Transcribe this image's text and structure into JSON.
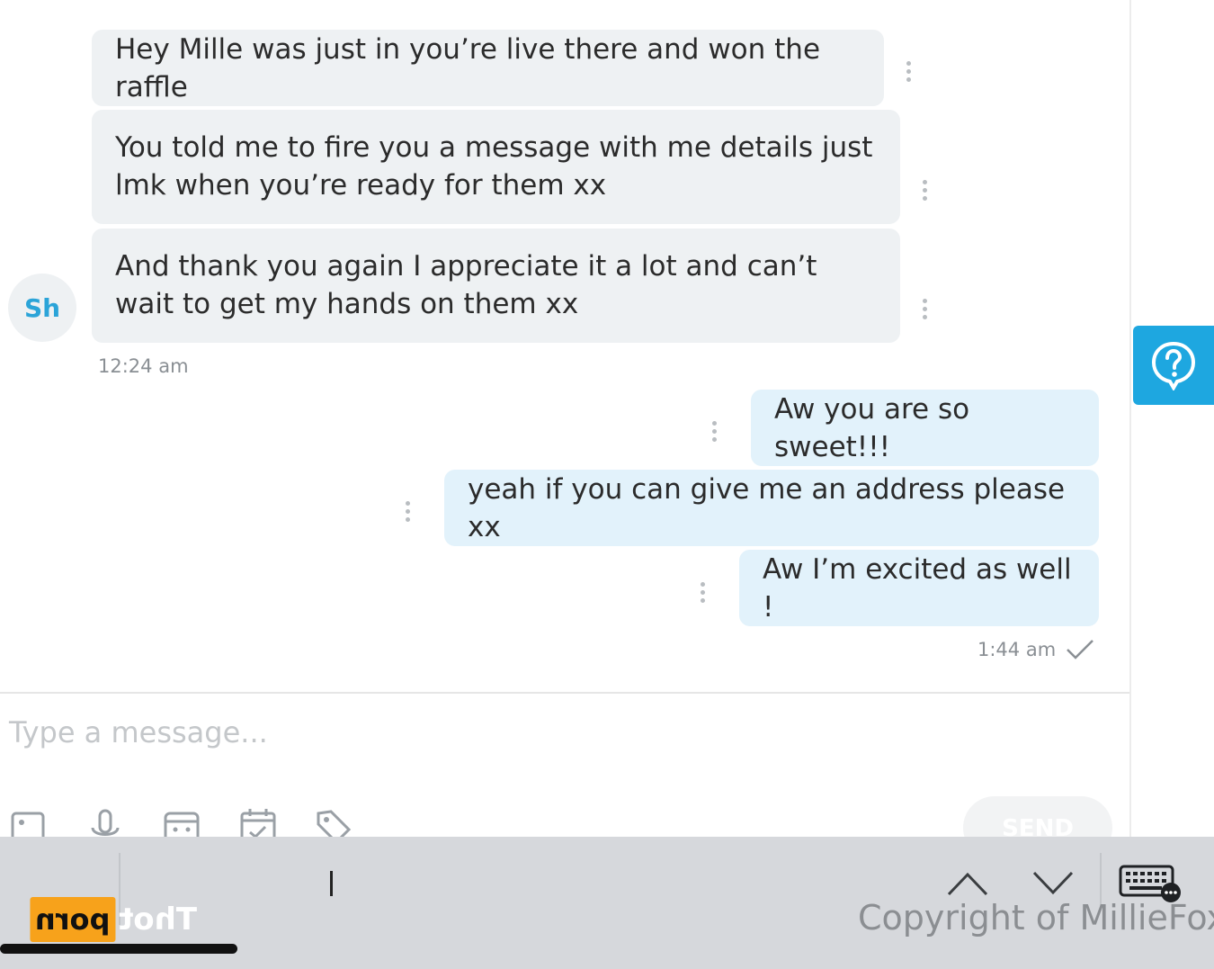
{
  "contact": {
    "avatar_initials": "Sh"
  },
  "messages_in": [
    {
      "text": "Hey Mille was just in you’re live there and won the raffle"
    },
    {
      "text": "You told me to fire you a message with me details just lmk when you’re ready for them xx"
    },
    {
      "text": "And thank you again I appreciate it a lot and can’t wait to get my hands on them xx"
    }
  ],
  "messages_in_time": "12:24 am",
  "messages_out": [
    {
      "text": "Aw you are so sweet!!!"
    },
    {
      "text": "yeah if you can give me an address please xx"
    },
    {
      "text": "Aw I’m excited as well !"
    }
  ],
  "messages_out_time": "1:44 am",
  "composer": {
    "placeholder": "Type a message...",
    "send_label": "SEND",
    "tools": [
      "image-icon",
      "microphone-icon",
      "vault-icon",
      "calendar-icon",
      "price-tag-icon"
    ]
  },
  "help": {
    "icon": "question-icon"
  },
  "keyboard_bar": {
    "watermark": "Copyright of MillieFox",
    "logo_box": "porn",
    "logo_text": "Thot"
  },
  "colors": {
    "incoming_bubble": "#eef1f3",
    "outgoing_bubble": "#e2f2fb",
    "accent": "#1ea7e0"
  }
}
